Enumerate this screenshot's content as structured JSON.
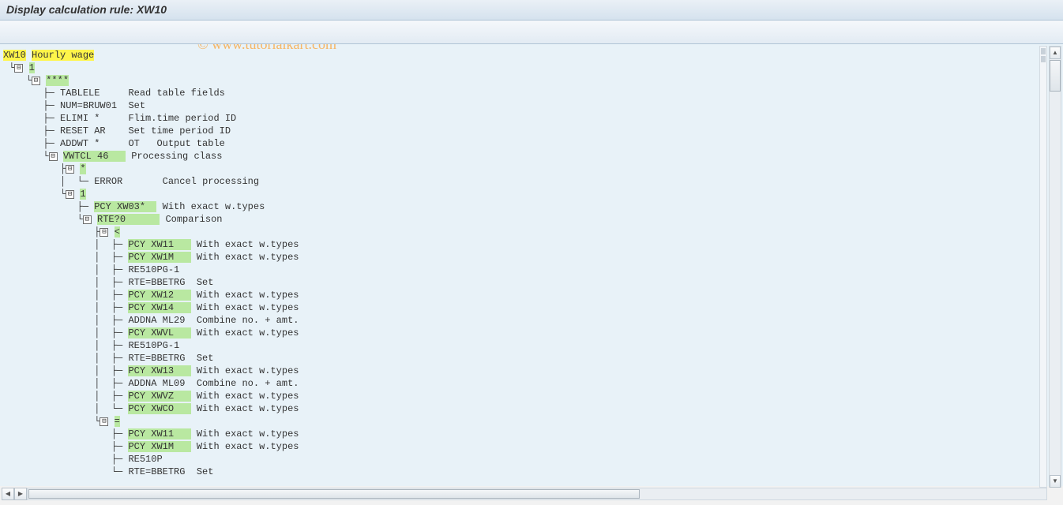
{
  "title": "Display calculation rule: XW10",
  "watermark": "© www.tutorialkart.com",
  "root": {
    "code": "XW10",
    "label": "Hourly wage"
  },
  "tree_lines": [
    {
      "indent": 0,
      "exp": true,
      "text": "1",
      "hl": "green"
    },
    {
      "indent": 1,
      "exp": true,
      "text": "****",
      "hl": "green"
    },
    {
      "indent": 2,
      "leaf": true,
      "op": "TABLELE",
      "desc": "Read table fields"
    },
    {
      "indent": 2,
      "leaf": true,
      "op": "NUM=BRUW01",
      "desc": "Set"
    },
    {
      "indent": 2,
      "leaf": true,
      "op": "ELIMI *",
      "desc": "Flim.time period ID"
    },
    {
      "indent": 2,
      "leaf": true,
      "op": "RESET AR",
      "desc": "Set time period ID"
    },
    {
      "indent": 2,
      "leaf": true,
      "op": "ADDWT *",
      "desc": "OT   Output table"
    },
    {
      "indent": 2,
      "exp": true,
      "op": "VWTCL 46",
      "desc": "Processing class",
      "hl": "green"
    },
    {
      "indent": 3,
      "exp": true,
      "op": "*",
      "hl": "green"
    },
    {
      "indent": 4,
      "leaf": true,
      "op": "ERROR",
      "desc": "Cancel processing"
    },
    {
      "indent": 3,
      "exp": true,
      "op": "1",
      "hl": "green"
    },
    {
      "indent": 4,
      "leaf": true,
      "op": "PCY XW03*",
      "desc": "With exact w.types",
      "hl": "green"
    },
    {
      "indent": 4,
      "exp": true,
      "op": "RTE?0",
      "desc": "Comparison",
      "hl": "green"
    },
    {
      "indent": 5,
      "exp": true,
      "op": "<",
      "hl": "green"
    },
    {
      "indent": 6,
      "leaf": true,
      "op": "PCY XW11",
      "desc": "With exact w.types",
      "hl": "green"
    },
    {
      "indent": 6,
      "leaf": true,
      "op": "PCY XW1M",
      "desc": "With exact w.types",
      "hl": "green"
    },
    {
      "indent": 6,
      "leaf": true,
      "op": "RE510PG-1",
      "desc": ""
    },
    {
      "indent": 6,
      "leaf": true,
      "op": "RTE=BBETRG",
      "desc": "Set"
    },
    {
      "indent": 6,
      "leaf": true,
      "op": "PCY XW12",
      "desc": "With exact w.types",
      "hl": "green"
    },
    {
      "indent": 6,
      "leaf": true,
      "op": "PCY XW14",
      "desc": "With exact w.types",
      "hl": "green"
    },
    {
      "indent": 6,
      "leaf": true,
      "op": "ADDNA ML29",
      "desc": "Combine no. + amt."
    },
    {
      "indent": 6,
      "leaf": true,
      "op": "PCY XWVL",
      "desc": "With exact w.types",
      "hl": "green"
    },
    {
      "indent": 6,
      "leaf": true,
      "op": "RE510PG-1",
      "desc": ""
    },
    {
      "indent": 6,
      "leaf": true,
      "op": "RTE=BBETRG",
      "desc": "Set"
    },
    {
      "indent": 6,
      "leaf": true,
      "op": "PCY XW13",
      "desc": "With exact w.types",
      "hl": "green"
    },
    {
      "indent": 6,
      "leaf": true,
      "op": "ADDNA ML09",
      "desc": "Combine no. + amt."
    },
    {
      "indent": 6,
      "leaf": true,
      "op": "PCY XWVZ",
      "desc": "With exact w.types",
      "hl": "green"
    },
    {
      "indent": 6,
      "leaf": true,
      "op": "PCY XWCO",
      "desc": "With exact w.types",
      "hl": "green"
    },
    {
      "indent": 5,
      "exp": true,
      "op": "=",
      "hl": "green"
    },
    {
      "indent": 6,
      "leaf": true,
      "op": "PCY XW11",
      "desc": "With exact w.types",
      "hl": "green"
    },
    {
      "indent": 6,
      "leaf": true,
      "op": "PCY XW1M",
      "desc": "With exact w.types",
      "hl": "green"
    },
    {
      "indent": 6,
      "leaf": true,
      "op": "RE510P",
      "desc": ""
    },
    {
      "indent": 6,
      "leaf": true,
      "op": "RTE=BBETRG",
      "desc": "Set"
    }
  ],
  "op_col_chars": 11
}
